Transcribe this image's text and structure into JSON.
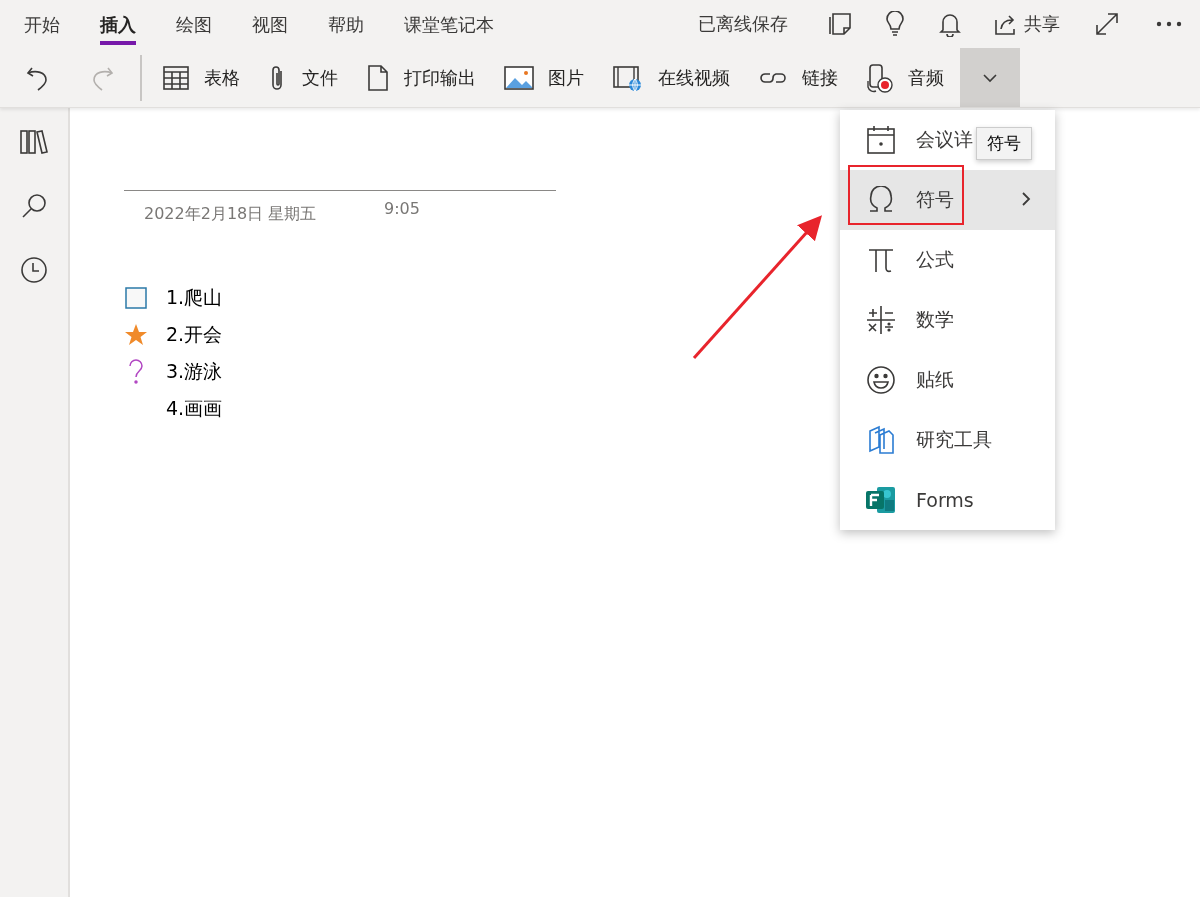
{
  "tabs": [
    {
      "label": "开始",
      "selected": false
    },
    {
      "label": "插入",
      "selected": true
    },
    {
      "label": "绘图",
      "selected": false
    },
    {
      "label": "视图",
      "selected": false
    },
    {
      "label": "帮助",
      "selected": false
    },
    {
      "label": "课堂笔记本",
      "selected": false
    }
  ],
  "status": "已离线保存",
  "share": {
    "label": "共享"
  },
  "toolbar": {
    "undo": {
      "disabled": false
    },
    "redo": {
      "disabled": true
    },
    "items": [
      {
        "kind": "table",
        "label": "表格"
      },
      {
        "kind": "attach",
        "label": "文件"
      },
      {
        "kind": "document",
        "label": "打印输出"
      },
      {
        "kind": "image",
        "label": "图片"
      },
      {
        "kind": "video",
        "label": "在线视频"
      },
      {
        "kind": "link",
        "label": "链接"
      },
      {
        "kind": "audio",
        "label": "音频"
      }
    ],
    "more": {
      "expanded": true
    }
  },
  "page": {
    "date": "2022年2月18日 星期五",
    "time": "9:05",
    "notes": [
      {
        "kind": "todo",
        "text": "1.爬山"
      },
      {
        "kind": "star",
        "text": "2.开会"
      },
      {
        "kind": "question",
        "text": "3.游泳"
      },
      {
        "kind": "plain",
        "text": "4.画画"
      }
    ]
  },
  "menu": {
    "items": [
      {
        "kind": "calendar",
        "label": "会议详",
        "selected": false,
        "submenu": false
      },
      {
        "kind": "omega",
        "label": "符号",
        "selected": true,
        "submenu": true
      },
      {
        "kind": "pi",
        "label": "公式",
        "selected": false,
        "submenu": false
      },
      {
        "kind": "math",
        "label": "数学",
        "selected": false,
        "submenu": false
      },
      {
        "kind": "smiley",
        "label": "贴纸",
        "selected": false,
        "submenu": false
      },
      {
        "kind": "research",
        "label": "研究工具",
        "selected": false,
        "submenu": false
      },
      {
        "kind": "forms",
        "label": "Forms",
        "selected": false,
        "submenu": false
      }
    ]
  },
  "tooltip": {
    "text": "符号"
  }
}
